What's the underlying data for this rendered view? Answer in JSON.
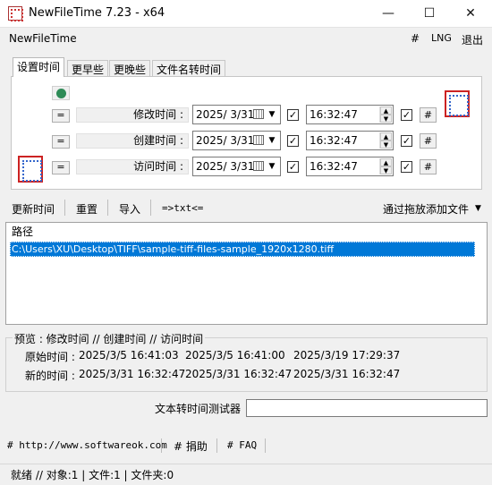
{
  "window": {
    "title": "NewFileTime 7.23 - x64",
    "minimize": "—",
    "maximize": "☐",
    "close": "✕"
  },
  "menubar": {
    "app": "NewFileTime",
    "hash": "#",
    "lng": "LNG",
    "exit": "退出"
  },
  "tabs": [
    "设置时间",
    "更早些",
    "更晚些",
    "文件名转时间"
  ],
  "rows": [
    {
      "eq": "=",
      "label": "修改时间 :",
      "date": "2025/ 3/31",
      "checked": "✓",
      "time": "16:32:47",
      "hash": "#"
    },
    {
      "eq": "=",
      "label": "创建时间 :",
      "date": "2025/ 3/31",
      "checked": "✓",
      "time": "16:32:47",
      "hash": "#"
    },
    {
      "eq": "=",
      "label": "访问时间 :",
      "date": "2025/ 3/31",
      "checked": "✓",
      "time": "16:32:47",
      "hash": "#"
    }
  ],
  "toolbar": {
    "update": "更新时间",
    "reset": "重置",
    "import": "导入",
    "txt": "=>txt<=",
    "add": "通过拖放添加文件",
    "add_arrow": "▼"
  },
  "list": {
    "header": "路径",
    "items": [
      "C:\\Users\\XU\\Desktop\\TIFF\\sample-tiff-files-sample_1920x1280.tiff"
    ]
  },
  "preview": {
    "heading": "预览 :   修改时间   //   创建时间   //   访问时间",
    "original_label": "原始时间 :",
    "original": [
      "2025/3/5 16:41:03",
      "2025/3/5 16:41:00",
      "2025/3/19 17:29:37"
    ],
    "new_label": "新的时间 :",
    "new": [
      "2025/3/31 16:32:47",
      "2025/3/31 16:32:47",
      "2025/3/31 16:32:47"
    ]
  },
  "tester": {
    "label": "文本转时间测试器",
    "value": ""
  },
  "links": [
    "# http://www.softwareok.com",
    "# 捐助",
    "# FAQ"
  ],
  "status": "就绪 // 对象:1  | 文件:1  | 文件夹:0",
  "icons": {
    "calendar": "calendar-icon",
    "dropdown": "chevron-down-icon",
    "clock": "clock-icon"
  }
}
